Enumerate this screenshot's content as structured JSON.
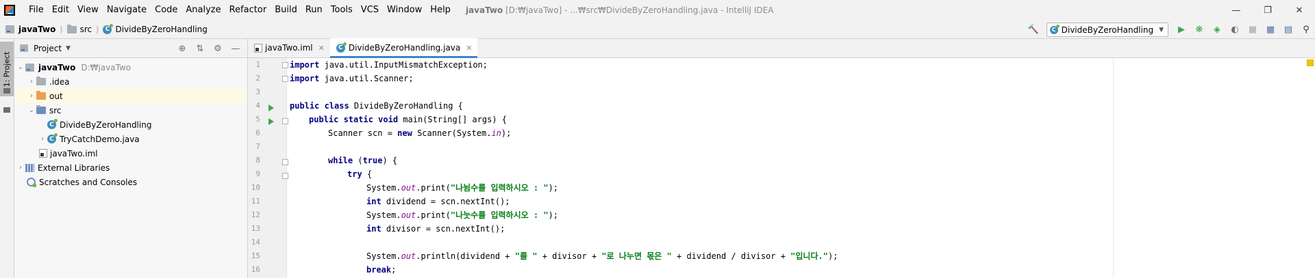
{
  "app": {
    "menu": [
      "File",
      "Edit",
      "View",
      "Navigate",
      "Code",
      "Analyze",
      "Refactor",
      "Build",
      "Run",
      "Tools",
      "VCS",
      "Window",
      "Help"
    ],
    "title_project": "javaTwo",
    "title_path": "[D:₩javaTwo] - ...₩src₩DivideByZeroHandling.java - IntelliJ IDEA"
  },
  "navbar": {
    "crumbs": [
      "javaTwo",
      "src",
      "DivideByZeroHandling"
    ],
    "run_config": "DivideByZeroHandling"
  },
  "side_strip": {
    "project_tab": "1: Project"
  },
  "project_panel": {
    "title": "Project",
    "tree": [
      {
        "label": "javaTwo",
        "hint": "D:₩javaTwo"
      },
      {
        "label": ".idea"
      },
      {
        "label": "out"
      },
      {
        "label": "src"
      },
      {
        "label": "DivideByZeroHandling"
      },
      {
        "label": "TryCatchDemo.java"
      },
      {
        "label": "javaTwo.iml"
      },
      {
        "label": "External Libraries"
      },
      {
        "label": "Scratches and Consoles"
      }
    ]
  },
  "editor": {
    "tabs": [
      {
        "label": "javaTwo.iml"
      },
      {
        "label": "DivideByZeroHandling.java"
      }
    ],
    "line_numbers": [
      "1",
      "2",
      "3",
      "4",
      "5",
      "6",
      "7",
      "8",
      "9",
      "10",
      "11",
      "12",
      "13",
      "14",
      "15",
      "16"
    ],
    "code": {
      "l1_kw": "import",
      "l1_rest": " java.util.InputMismatchException;",
      "l2_kw": "import",
      "l2_rest": " java.util.Scanner;",
      "l4_kw": "public class",
      "l4_rest": " DivideByZeroHandling {",
      "l5_kw": "public static void",
      "l5_rest": " main(String[] args) {",
      "l6_a": "Scanner scn = ",
      "l6_kw": "new",
      "l6_b": " Scanner(System.",
      "l6_fld": "in",
      "l6_c": ");",
      "l8_kw": "while",
      "l8_a": " (",
      "l8_kw2": "true",
      "l8_b": ") {",
      "l9_kw": "try",
      "l9_rest": " {",
      "l10_a": "System.",
      "l10_fld": "out",
      "l10_b": ".print(",
      "l10_str": "\"나뉨수를 입력하시오 : \"",
      "l10_c": ");",
      "l11_kw": "int",
      "l11_rest": " dividend = scn.nextInt();",
      "l12_a": "System.",
      "l12_fld": "out",
      "l12_b": ".print(",
      "l12_str": "\"나눗수를 입력하시오 : \"",
      "l12_c": ");",
      "l13_kw": "int",
      "l13_rest": " divisor = scn.nextInt();",
      "l15_a": "System.",
      "l15_fld": "out",
      "l15_b": ".println(dividend + ",
      "l15_s1": "\"를 \"",
      "l15_c": " + divisor + ",
      "l15_s2": "\"로 나누면 몫은 \"",
      "l15_d": " + dividend / divisor + ",
      "l15_s3": "\"입니다.\"",
      "l15_e": ");",
      "l16_kw": "break",
      "l16_rest": ";"
    }
  }
}
